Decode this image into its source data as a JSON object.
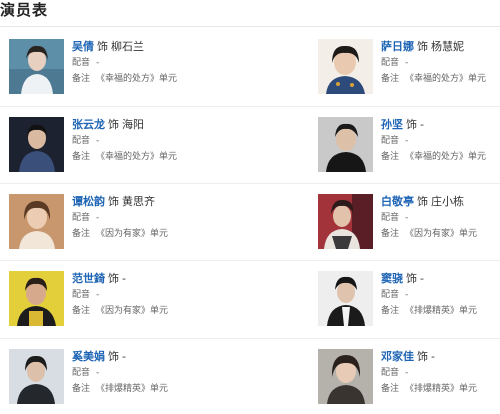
{
  "header": {
    "title": "演员表"
  },
  "labels": {
    "as": "饰",
    "dub": "配音",
    "note": "备注"
  },
  "colors": {
    "actor_link": "#1e64b4",
    "rule": "#e6e6e6"
  },
  "cast": [
    {
      "actor": "吴倩",
      "role": "柳石兰",
      "dub": "-",
      "note": "《幸福的处方》单元"
    },
    {
      "actor": "萨日娜",
      "role": "杨慧妮",
      "dub": "-",
      "note": "《幸福的处方》单元"
    },
    {
      "actor": "张云龙",
      "role": "海阳",
      "dub": "-",
      "note": "《幸福的处方》单元"
    },
    {
      "actor": "孙坚",
      "role": "-",
      "dub": "-",
      "note": "《幸福的处方》单元"
    },
    {
      "actor": "谭松韵",
      "role": "黄思齐",
      "dub": "-",
      "note": "《因为有家》单元"
    },
    {
      "actor": "白敬亭",
      "role": "庄小栋",
      "dub": "-",
      "note": "《因为有家》单元"
    },
    {
      "actor": "范世錡",
      "role": "-",
      "dub": "-",
      "note": "《因为有家》单元"
    },
    {
      "actor": "窦骁",
      "role": "-",
      "dub": "-",
      "note": "《排爆精英》单元"
    },
    {
      "actor": "奚美娟",
      "role": "-",
      "dub": "-",
      "note": "《排爆精英》单元"
    },
    {
      "actor": "邓家佳",
      "role": "-",
      "dub": "-",
      "note": "《排爆精英》单元"
    }
  ]
}
